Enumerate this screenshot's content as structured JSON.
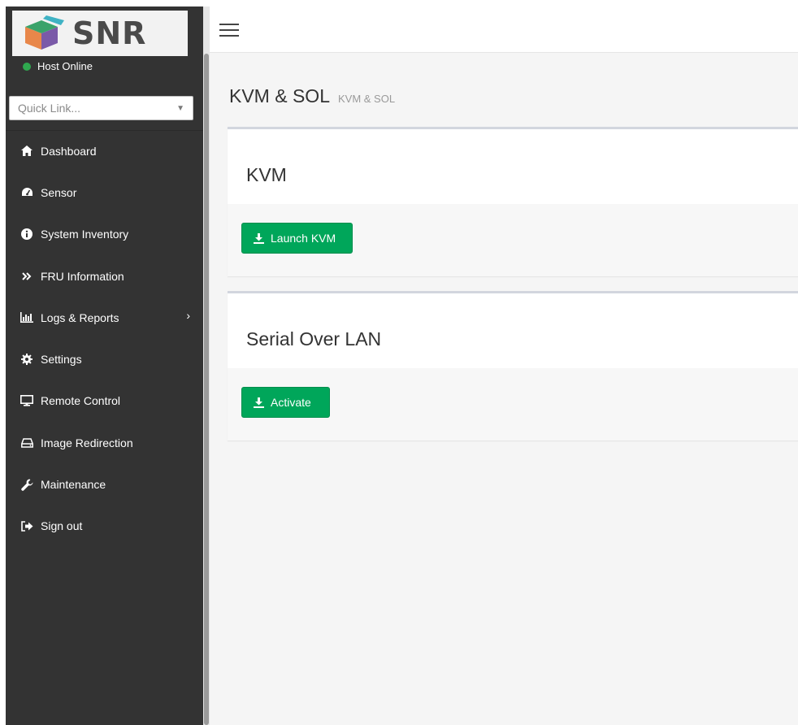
{
  "sidebar": {
    "logo_text": "SNR",
    "host_status": "Host Online",
    "quick_link_placeholder": "Quick Link...",
    "items": [
      {
        "label": "Dashboard",
        "icon": "home-icon"
      },
      {
        "label": "Sensor",
        "icon": "gauge-icon"
      },
      {
        "label": "System Inventory",
        "icon": "info-icon"
      },
      {
        "label": "FRU Information",
        "icon": "double-chevron-icon"
      },
      {
        "label": "Logs & Reports",
        "icon": "bar-chart-icon",
        "has_submenu": true
      },
      {
        "label": "Settings",
        "icon": "gear-icon"
      },
      {
        "label": "Remote Control",
        "icon": "monitor-icon"
      },
      {
        "label": "Image Redirection",
        "icon": "hdd-icon"
      },
      {
        "label": "Maintenance",
        "icon": "wrench-icon"
      },
      {
        "label": "Sign out",
        "icon": "sign-out-icon"
      }
    ]
  },
  "page": {
    "title": "KVM & SOL",
    "subtitle": "KVM & SOL"
  },
  "kvm_box": {
    "title": "KVM",
    "button_label": "Launch KVM"
  },
  "sol_box": {
    "title": "Serial Over LAN",
    "button_label": "Activate"
  },
  "colors": {
    "sidebar_bg": "#333333",
    "button_green": "#00a65a",
    "status_green": "#2fa84f"
  }
}
